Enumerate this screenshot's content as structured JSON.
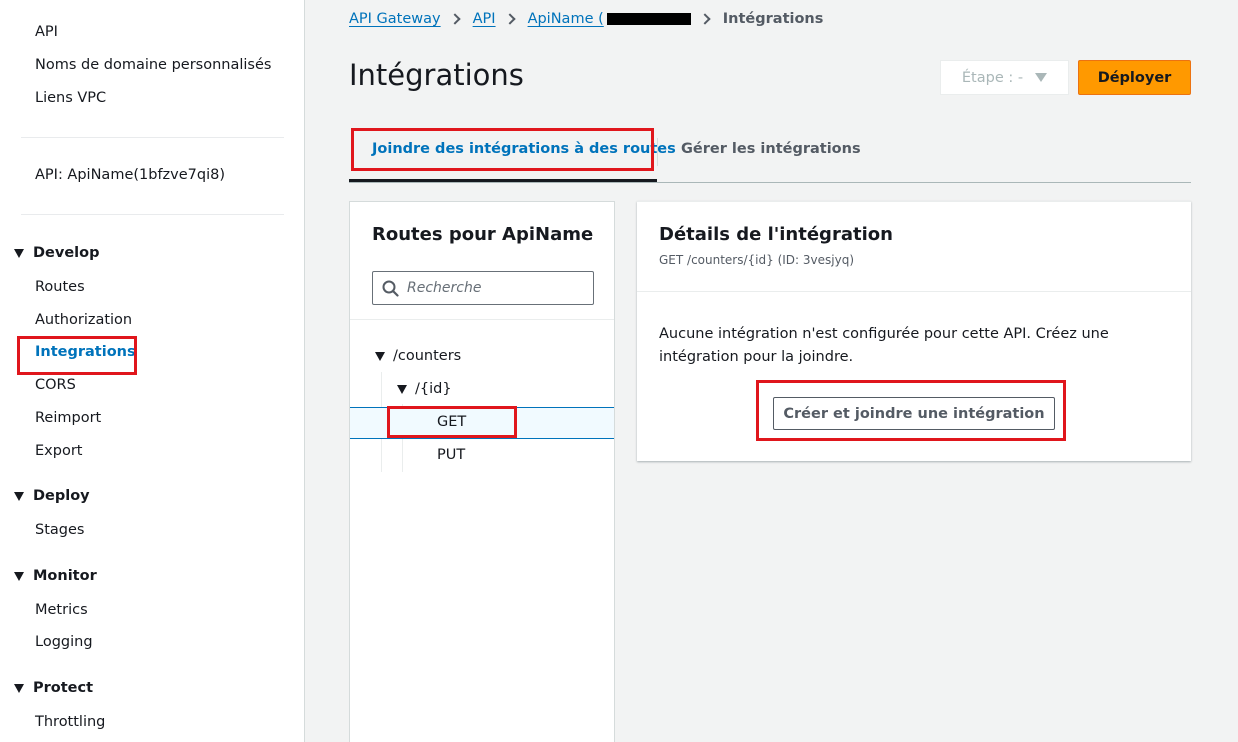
{
  "sidebar": {
    "top_links": [
      "API",
      "Noms de domaine personnalisés",
      "Liens VPC"
    ],
    "api_label": "API: ApiName(1bfzve7qi8)",
    "develop": {
      "label": "Develop",
      "items": [
        "Routes",
        "Authorization",
        "Integrations",
        "CORS",
        "Reimport",
        "Export"
      ],
      "active": "Integrations"
    },
    "deploy": {
      "label": "Deploy",
      "items": [
        "Stages"
      ]
    },
    "monitor": {
      "label": "Monitor",
      "items": [
        "Metrics",
        "Logging"
      ]
    },
    "protect": {
      "label": "Protect",
      "items": [
        "Throttling"
      ]
    }
  },
  "breadcrumb": {
    "items": [
      "API Gateway",
      "API",
      "ApiName ("
    ],
    "current": "Intégrations"
  },
  "page": {
    "title": "Intégrations",
    "stage_select": "Étape : -",
    "deploy_button": "Déployer"
  },
  "tabs": {
    "attach": "Joindre des intégrations à des routes",
    "manage": "Gérer les intégrations",
    "active": "attach"
  },
  "routes_panel": {
    "title": "Routes pour ApiName",
    "search_placeholder": "Recherche",
    "tree": {
      "root": "/counters",
      "child": "/{id}",
      "methods": [
        "GET",
        "PUT"
      ],
      "selected": "GET"
    }
  },
  "details_panel": {
    "title": "Détails de l'intégration",
    "subtitle": "GET /counters/{id} (ID: 3vesjyq)",
    "message": "Aucune intégration n'est configurée pour cette API. Créez une intégration pour la joindre.",
    "create_button": "Créer et joindre une intégration"
  },
  "colors": {
    "link": "#0073bb",
    "deploy": "#ff9900",
    "highlight": "#e0161c"
  }
}
